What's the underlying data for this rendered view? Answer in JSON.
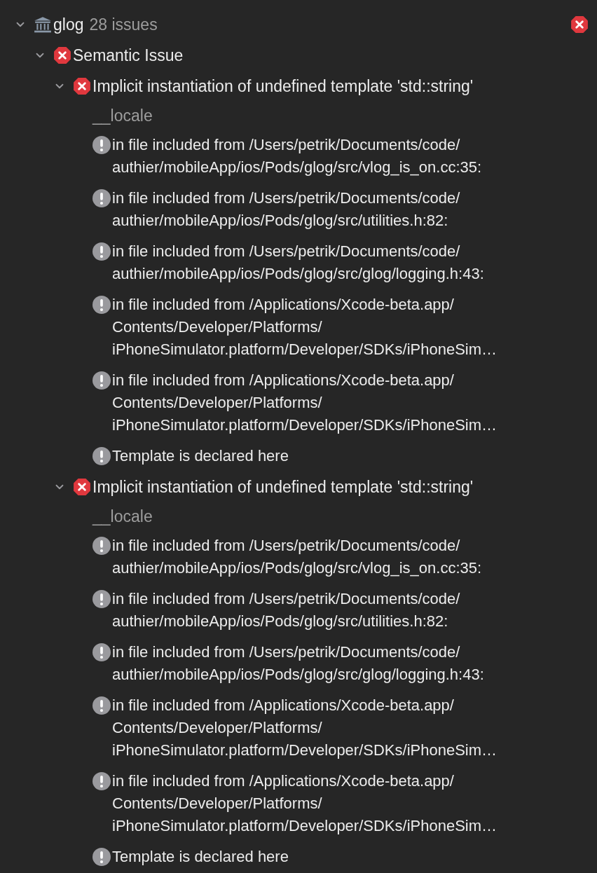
{
  "navigator": {
    "kind": "project",
    "label": "glog",
    "count": "28 issues",
    "expanded": true,
    "children": [
      {
        "kind": "error",
        "label": "Semantic Issue",
        "expanded": true,
        "children": [
          {
            "kind": "error",
            "label": "Implicit instantiation of undefined template 'std::string'",
            "detail": "__locale",
            "expanded": true,
            "children": [
              {
                "kind": "note",
                "lines": [
                  "in file included from /Users/petrik/Documents/code/",
                  "authier/mobileApp/ios/Pods/glog/src/vlog_is_on.cc:35:"
                ]
              },
              {
                "kind": "note",
                "lines": [
                  "in file included from /Users/petrik/Documents/code/",
                  "authier/mobileApp/ios/Pods/glog/src/utilities.h:82:"
                ]
              },
              {
                "kind": "note",
                "lines": [
                  "in file included from /Users/petrik/Documents/code/",
                  "authier/mobileApp/ios/Pods/glog/src/glog/logging.h:43:"
                ]
              },
              {
                "kind": "note",
                "lines": [
                  "in file included from /Applications/Xcode-beta.app/",
                  "Contents/Developer/Platforms/",
                  "iPhoneSimulator.platform/Developer/SDKs/iPhoneSim…"
                ]
              },
              {
                "kind": "note",
                "lines": [
                  "in file included from /Applications/Xcode-beta.app/",
                  "Contents/Developer/Platforms/",
                  "iPhoneSimulator.platform/Developer/SDKs/iPhoneSim…"
                ]
              },
              {
                "kind": "note",
                "lines": [
                  "Template is declared here"
                ]
              }
            ]
          },
          {
            "kind": "error",
            "label": "Implicit instantiation of undefined template 'std::string'",
            "detail": "__locale",
            "expanded": true,
            "children": [
              {
                "kind": "note",
                "lines": [
                  "in file included from /Users/petrik/Documents/code/",
                  "authier/mobileApp/ios/Pods/glog/src/vlog_is_on.cc:35:"
                ]
              },
              {
                "kind": "note",
                "lines": [
                  "in file included from /Users/petrik/Documents/code/",
                  "authier/mobileApp/ios/Pods/glog/src/utilities.h:82:"
                ]
              },
              {
                "kind": "note",
                "lines": [
                  "in file included from /Users/petrik/Documents/code/",
                  "authier/mobileApp/ios/Pods/glog/src/glog/logging.h:43:"
                ]
              },
              {
                "kind": "note",
                "lines": [
                  "in file included from /Applications/Xcode-beta.app/",
                  "Contents/Developer/Platforms/",
                  "iPhoneSimulator.platform/Developer/SDKs/iPhoneSim…"
                ]
              },
              {
                "kind": "note",
                "lines": [
                  "in file included from /Applications/Xcode-beta.app/",
                  "Contents/Developer/Platforms/",
                  "iPhoneSimulator.platform/Developer/SDKs/iPhoneSim…"
                ]
              },
              {
                "kind": "note",
                "lines": [
                  "Template is declared here"
                ]
              }
            ]
          }
        ]
      }
    ]
  }
}
